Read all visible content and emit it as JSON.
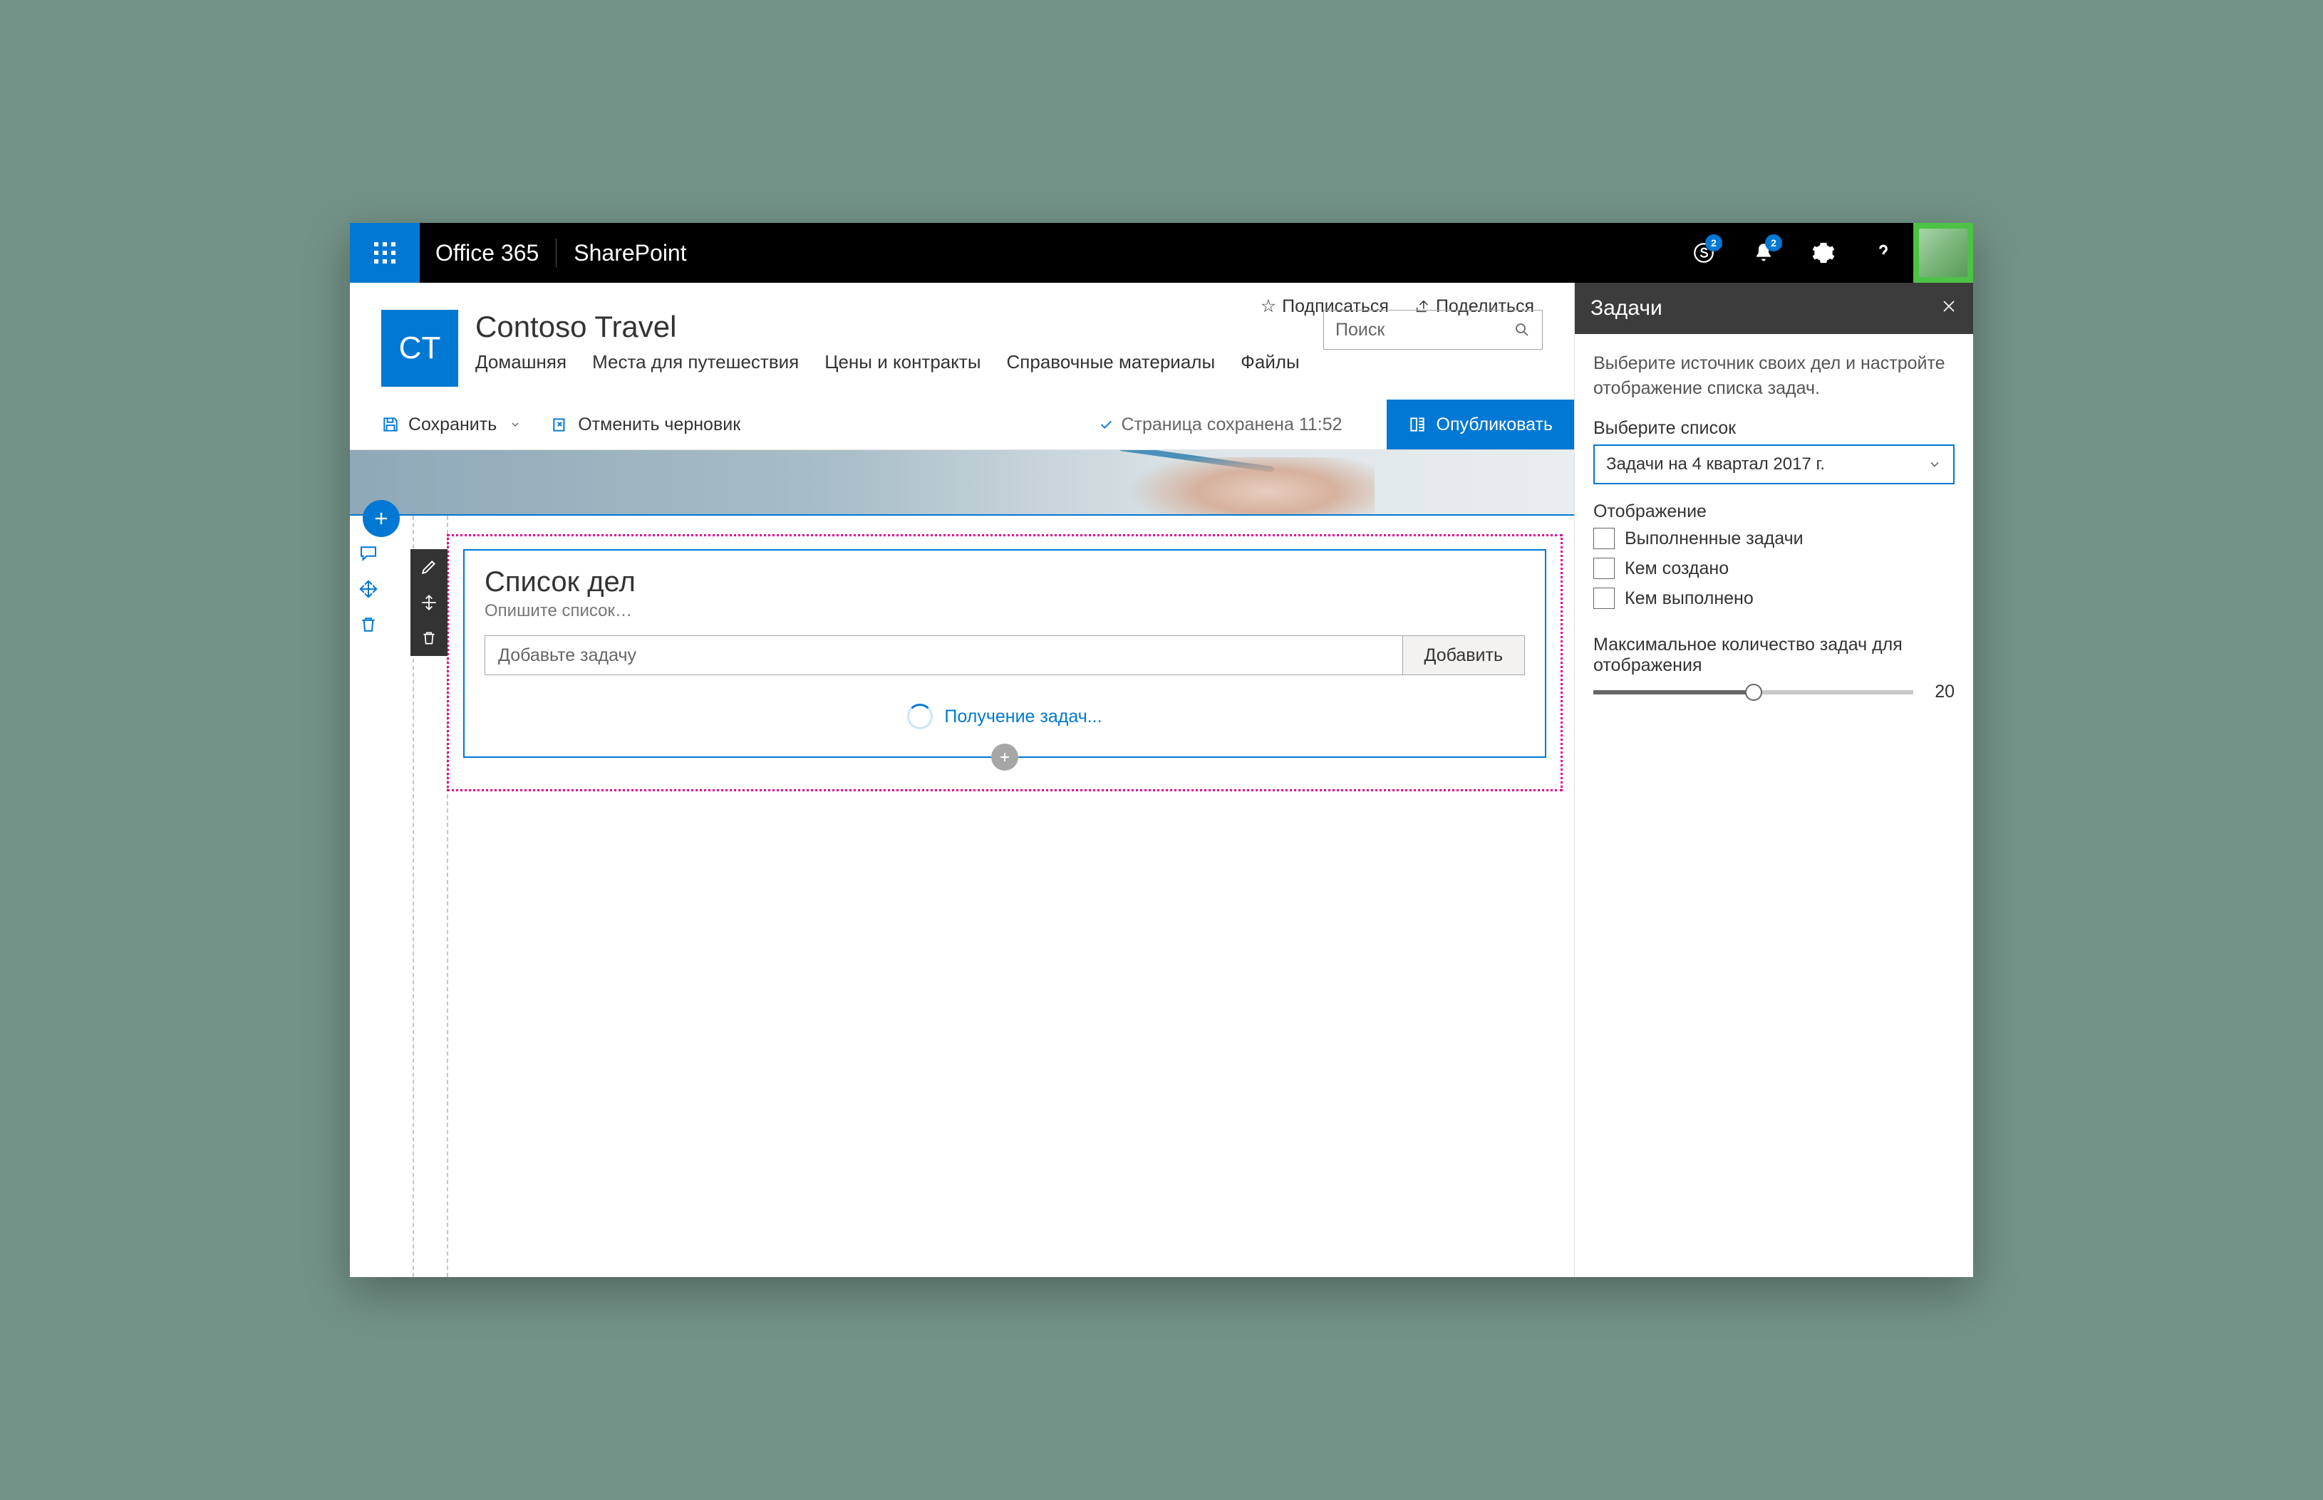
{
  "topbar": {
    "brand1": "Office 365",
    "brand2": "SharePoint",
    "skype_badge": "2",
    "bell_badge": "2"
  },
  "site": {
    "logo_text": "CT",
    "title": "Contoso Travel",
    "follow": "Подписаться",
    "share": "Поделиться",
    "nav": [
      "Домашняя",
      "Места для путешествия",
      "Цены и контракты",
      "Справочные материалы",
      "Файлы"
    ],
    "search_placeholder": "Поиск"
  },
  "cmdbar": {
    "save": "Сохранить",
    "discard": "Отменить черновик",
    "status": "Страница сохранена 11:52",
    "publish": "Опубликовать"
  },
  "webpart": {
    "title": "Список дел",
    "description_placeholder": "Опишите список…",
    "task_placeholder": "Добавьте задачу",
    "add_label": "Добавить",
    "loading": "Получение задач..."
  },
  "panel": {
    "title": "Задачи",
    "intro": "Выберите источник своих дел и настройте отображение списка задач.",
    "select_label": "Выберите список",
    "select_value": "Задачи на 4 квартал 2017 г.",
    "display_label": "Отображение",
    "chk_completed": "Выполненные задачи",
    "chk_createdby": "Кем создано",
    "chk_completedby": "Кем выполнено",
    "slider_label": "Максимальное количество задач для отображения",
    "slider_value": "20"
  }
}
